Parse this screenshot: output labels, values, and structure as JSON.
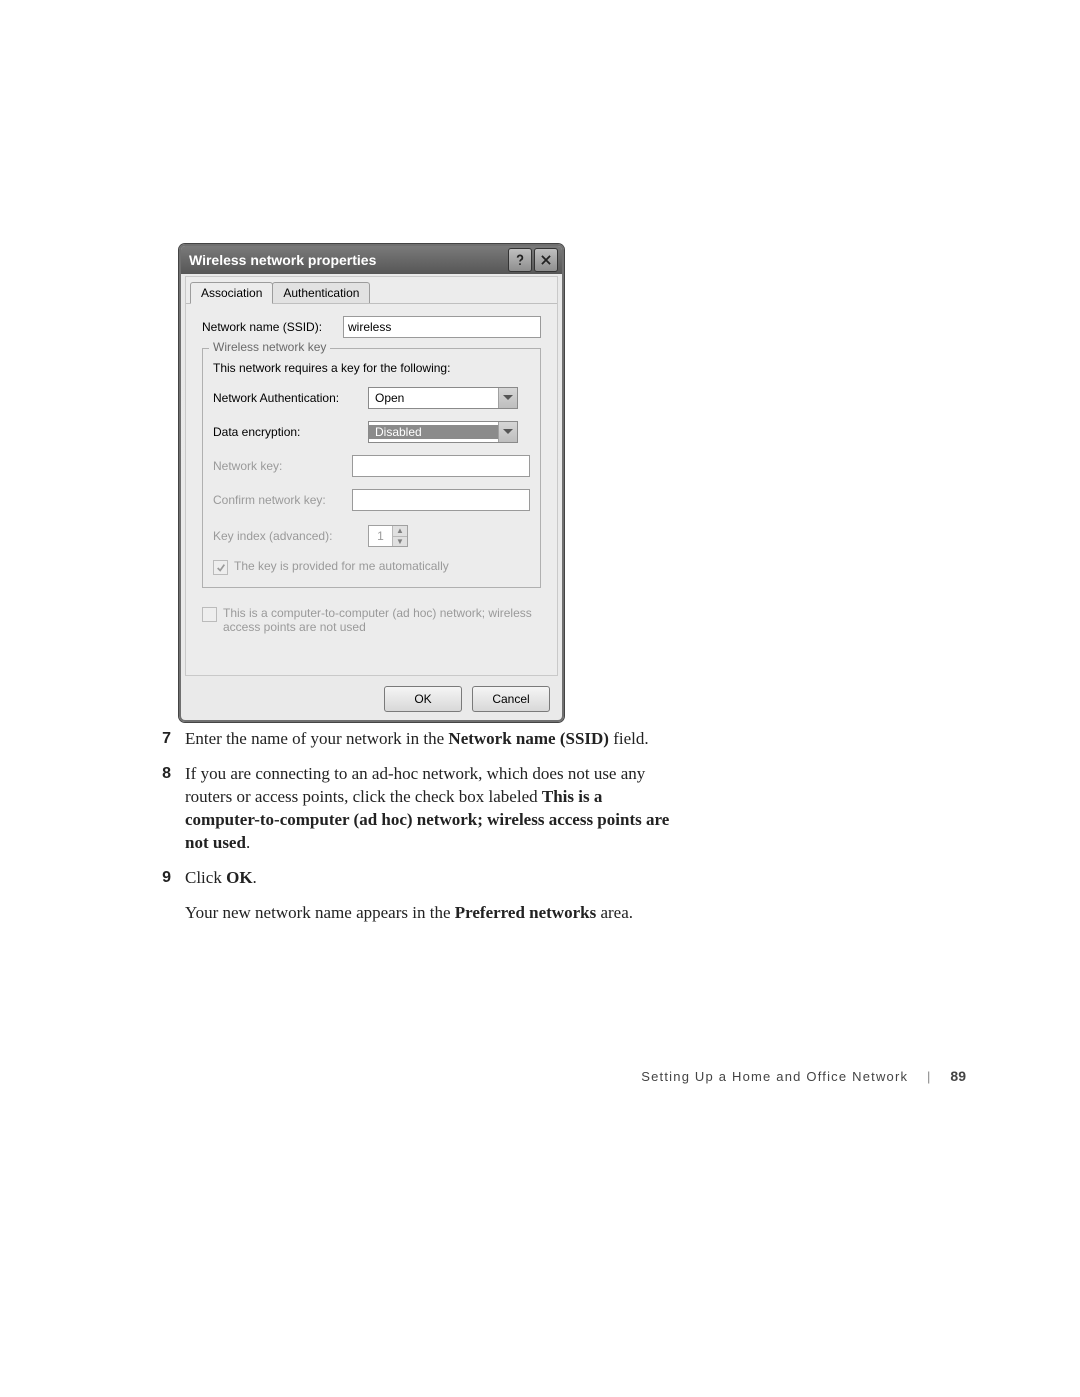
{
  "dialog": {
    "title": "Wireless network properties",
    "tabs": {
      "association": "Association",
      "authentication": "Authentication"
    },
    "ssid_label": "Network name (SSID):",
    "ssid_value": "wireless",
    "fieldset_legend": "Wireless network key",
    "fieldset_hint": "This network requires a key for the following:",
    "auth_label": "Network Authentication:",
    "auth_value": "Open",
    "encrypt_label": "Data encryption:",
    "encrypt_value": "Disabled",
    "key_label": "Network key:",
    "confirm_label": "Confirm network key:",
    "index_label": "Key index (advanced):",
    "index_value": "1",
    "auto_key_label": "The key is provided for me automatically",
    "adhoc_label": "This is a computer-to-computer (ad hoc) network; wireless access points are not used",
    "ok": "OK",
    "cancel": "Cancel"
  },
  "steps": {
    "n7": "7",
    "s7_a": "Enter the name of your network in the ",
    "s7_b": "Network name (SSID)",
    "s7_c": " field.",
    "n8": "8",
    "s8_a": "If you are connecting to an ad-hoc network, which does not use any routers or access points, click the check box labeled ",
    "s8_b": "This is a computer-to-computer (ad hoc) network; wireless access points are not used",
    "s8_c": ".",
    "n9": "9",
    "s9_a": "Click ",
    "s9_b": "OK",
    "s9_c": ".",
    "follow_a": "Your new network name appears in the ",
    "follow_b": "Preferred networks",
    "follow_c": " area."
  },
  "footer": {
    "section": "Setting Up a Home and Office Network",
    "page": "89"
  }
}
